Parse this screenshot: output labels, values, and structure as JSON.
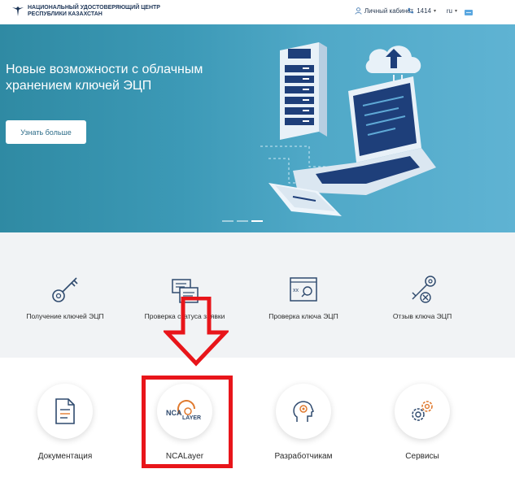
{
  "header": {
    "logo_line1": "НАЦИОНАЛЬНЫЙ УДОСТОВЕРЯЮЩИЙ ЦЕНТР",
    "logo_line2": "РЕСПУБЛИКИ КАЗАХСТАН",
    "cabinet_label": "Личный кабинет",
    "phone": "1414",
    "lang": "ru"
  },
  "hero": {
    "title": "Новые возможности с облачным хранением ключей ЭЦП",
    "button_label": "Узнать больше",
    "slides_total": 3,
    "slide_active": 3
  },
  "services": [
    {
      "label": "Получение ключей ЭЦП",
      "icon": "key-icon"
    },
    {
      "label": "Проверка статуса заявки",
      "icon": "document-check-icon"
    },
    {
      "label": "Проверка ключа ЭЦП",
      "icon": "certificate-icon"
    },
    {
      "label": "Отзыв ключа ЭЦП",
      "icon": "key-revoke-icon"
    }
  ],
  "tiles": [
    {
      "label": "Документация",
      "icon": "document-icon"
    },
    {
      "label": "NCALayer",
      "icon": "ncalayer-logo"
    },
    {
      "label": "Разработчикам",
      "icon": "developer-head-icon"
    },
    {
      "label": "Сервисы",
      "icon": "gears-icon"
    }
  ],
  "ncalayer_logo": {
    "top": "NCA",
    "bottom": "LAYER"
  },
  "colors": {
    "accent_orange": "#e07a2f",
    "highlight_red": "#e8151a",
    "hero_blue": "#3c99b6"
  }
}
